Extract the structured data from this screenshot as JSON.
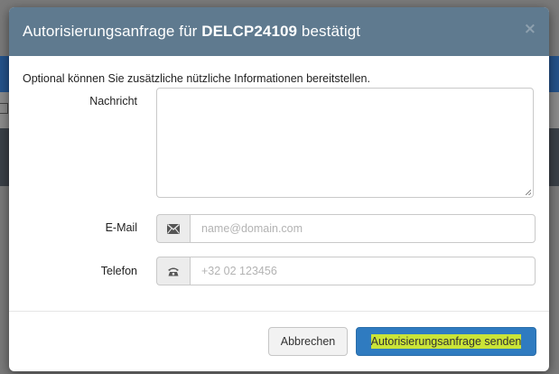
{
  "modal": {
    "title_prefix": "Autorisierungsanfrage für ",
    "title_code": "DELCP24109",
    "title_suffix": " bestätigt",
    "close_label": "×"
  },
  "form": {
    "intro": "Optional können Sie zusätzliche nützliche Informationen bereitstellen.",
    "message_label": "Nachricht",
    "message_value": "",
    "email_label": "E-Mail",
    "email_placeholder": "name@domain.com",
    "email_icon": "envelope-icon",
    "phone_label": "Telefon",
    "phone_placeholder": "+32 02 123456",
    "phone_icon": "phone-icon"
  },
  "footer": {
    "cancel_label": "Abbrechen",
    "send_label": "Autorisierungsanfrage senden",
    "highlight_color": "#d6ea2b"
  },
  "colors": {
    "header_bg": "#5f7a8f",
    "primary_button": "#2f7bc0"
  }
}
